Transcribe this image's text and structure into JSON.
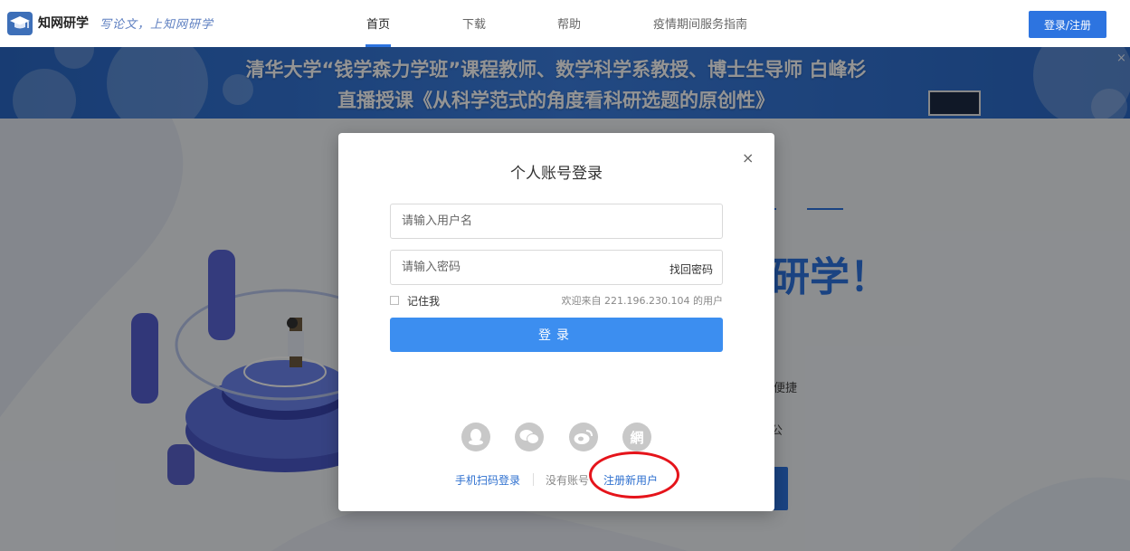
{
  "header": {
    "brand": "知网研学",
    "slogan": "写论文，上知网研学",
    "nav": [
      {
        "label": "首页",
        "active": true
      },
      {
        "label": "下载",
        "active": false
      },
      {
        "label": "帮助",
        "active": false
      },
      {
        "label": "疫情期间服务指南",
        "active": false
      }
    ],
    "login_register_label": "登录/注册",
    "accent_color": "#2d74e0"
  },
  "banner": {
    "line1": "清华大学“钱学森力学班”课程教师、数学科学系教授、博士生导师 白峰杉",
    "line2": "直播授课《从科学范式的角度看科研选题的原创性》",
    "close_label": "×"
  },
  "background_page": {
    "hero_title": "研学！",
    "feature_text_1": "便捷",
    "feature_text_2": "公"
  },
  "login_modal": {
    "title": "个人账号登录",
    "close_label": "×",
    "username_placeholder": "请输入用户名",
    "password_placeholder": "请输入密码",
    "forgot_password": "找回密码",
    "remember_me": "记住我",
    "welcome_text": "欢迎来自 221.196.230.104 的用户",
    "submit_label": "登录",
    "social_logins": [
      {
        "icon": "qq-icon",
        "glyph": "♟"
      },
      {
        "icon": "wechat-icon",
        "glyph": "◉"
      },
      {
        "icon": "weibo-icon",
        "glyph": "◎"
      },
      {
        "icon": "cnki-icon",
        "glyph": "網"
      }
    ],
    "qr_login": "手机扫码登录",
    "no_account": "没有账号",
    "register_new": "注册新用户"
  }
}
